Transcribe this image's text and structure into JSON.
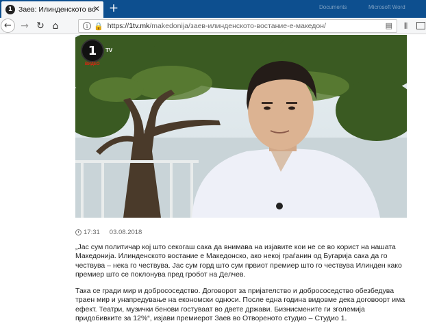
{
  "browser": {
    "tab": {
      "favicon": "1",
      "title": "Заев: Илинденското востание е македон",
      "close": "✕"
    },
    "new_tab": "+",
    "window_labels": [
      "Documents",
      "Microsoft Word"
    ],
    "nav": {
      "back": "←",
      "forward": "→",
      "reload": "↻",
      "home": "⌂"
    },
    "url": {
      "info": "i",
      "lock": "🔒",
      "scheme": "https://",
      "host": "1tv.mk",
      "path": "/makedonija/заев-илинденското-востание-е-македон/",
      "reader": "▤"
    },
    "library_icon": "⫴"
  },
  "article": {
    "hero": {
      "logo": "1",
      "logo_sub": "ВИДЕО",
      "logo_tv": "TV"
    },
    "time": "17:31",
    "date": "03.08.2018",
    "paragraphs": [
      "„Јас сум политичар кој што секогаш сака да внимава на изјавите кои не се во корист на нашата Македонија. Илинденското востание е Македонско, ако некој граѓанин од Бугарија сака да го чествува – нека го чествува. Јас сум горд што сум првиот премиер што го чествува Илинден како премиер што се поклонува пред гробот на Делчев.",
      "Така се гради мир и добрососедство. Договорот за пријателство и добрососедство обезбедува траен мир и унапредување на економски односи. После една година видовме дека договоорт има ефект. Театри, музички бенови гостуваат во двете држави. Бизнисмените ги зголемија придобивките за 12%“, изјави премиерот Заев во Отвореното студио – Студио 1."
    ]
  }
}
